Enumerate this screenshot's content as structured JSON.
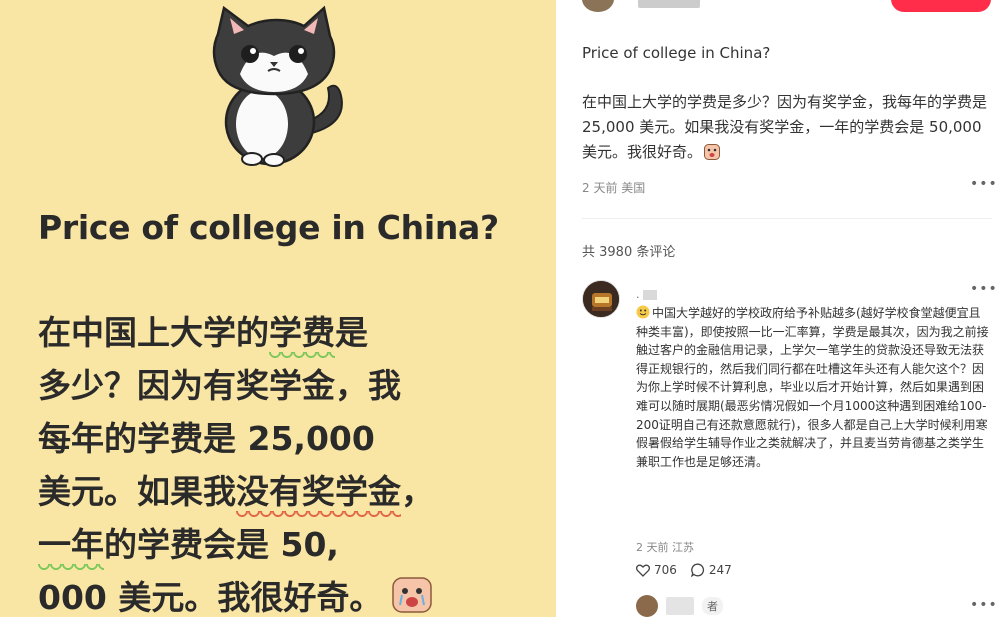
{
  "card": {
    "title": "Price of college in China?",
    "lines": [
      {
        "a": "在中国上大学的",
        "ul_green": "学费",
        "b": "是"
      },
      {
        "a": "多少？因为有奖学金，我"
      },
      {
        "a": "每年的学费是 25,000"
      },
      {
        "a": " 美元。如果我",
        "ul_red": "没有奖学金",
        "b": "，"
      },
      {
        "ul_green": "一年",
        "a": "的学费会是 50,"
      },
      {
        "a": "000 美元。我很好奇。"
      }
    ]
  },
  "post": {
    "title": "Price of college in China?",
    "body": "在中国上大学的学费是多少？因为有奖学金，我每年的学费是 25,000 美元。如果我没有奖学金，一年的学费会是 50,000 美元。我很好奇。",
    "meta": "2 天前 美国",
    "more_icon": "ellipsis-icon"
  },
  "comments_header": "共 3980 条评论",
  "comment": {
    "name_prefix": ".",
    "text": "中国大学越好的学校政府给予补贴越多(越好学校食堂越便宜且种类丰富)，即使按照一比一汇率算，学费是最其次，因为我之前接触过客户的金融信用记录，上学欠一笔学生的贷款没还导致无法获得正规银行的，然后我们同行都在吐槽这年头还有人能欠这个？因为你上学时候不计算利息，毕业以后才开始计算，然后如果遇到困难可以随时展期(最恶劣情况假如一个月1000这种遇到困难给100-200证明自己有还款意愿就行)，很多人都是自己上大学时候利用寒假暑假给学生辅导作业之类就解决了，并且麦当劳肯德基之类学生兼职工作也是足够还清。",
    "meta": "2 天前 江苏",
    "likes": "706",
    "replies": "247",
    "reply_tag": "者"
  },
  "colors": {
    "card_bg": "#fae6a4",
    "follow_red": "#ff2d49",
    "green_underline": "#7cc85a",
    "red_underline": "#e2654a"
  }
}
